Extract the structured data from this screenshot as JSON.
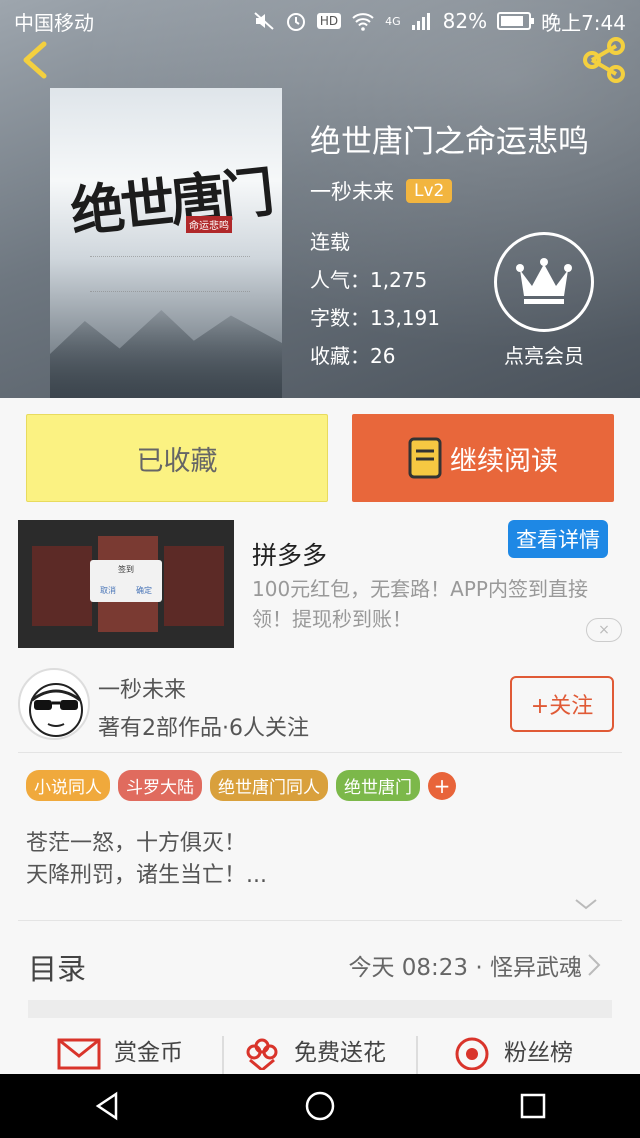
{
  "status_bar": {
    "carrier": "中国移动",
    "signal_label": "4G",
    "battery": "82%",
    "time": "晚上7:44",
    "hd_badge": "HD"
  },
  "book": {
    "title": "绝世唐门之命运悲鸣",
    "cover_title": "绝世唐门",
    "cover_stamp": "命运悲鸣",
    "author": "一秒未来",
    "level": "Lv2",
    "status": "连载",
    "popularity": "人气：1,275",
    "word_count": "字数：13,191",
    "favorites": "收藏：26"
  },
  "vip": {
    "label": "点亮会员"
  },
  "buttons": {
    "favorited": "已收藏",
    "continue_reading": "继续阅读"
  },
  "ad": {
    "title": "拼多多",
    "cta": "查看详情",
    "description": "100元红包，无套路！APP内签到直接领！提现秒到账！",
    "close": "×",
    "dialog_title": "签到",
    "dialog_cancel": "取消",
    "dialog_confirm": "确定"
  },
  "author_card": {
    "name": "一秒未来",
    "works": "著有2部作品·6人关注",
    "follow": "+关注"
  },
  "tags": [
    {
      "label": "小说同人",
      "color": "#f0a93c"
    },
    {
      "label": "斗罗大陆",
      "color": "#e06b5e"
    },
    {
      "label": "绝世唐门同人",
      "color": "#d9a03c"
    },
    {
      "label": "绝世唐门",
      "color": "#7cb84a"
    }
  ],
  "tag_add": "+",
  "intro": {
    "line1": "苍茫一怒，十方俱灭！",
    "line2": "天降刑罚，诸生当亡！..."
  },
  "toc": {
    "label": "目录",
    "latest": "今天 08:23 · 怪异武魂"
  },
  "actions": {
    "reward": "赏金币",
    "flower": "免费送花",
    "fans": "粉丝榜"
  },
  "colors": {
    "accent_orange": "#e8673b",
    "favorite_yellow": "#fbf282",
    "ad_blue": "#1e88e5"
  }
}
